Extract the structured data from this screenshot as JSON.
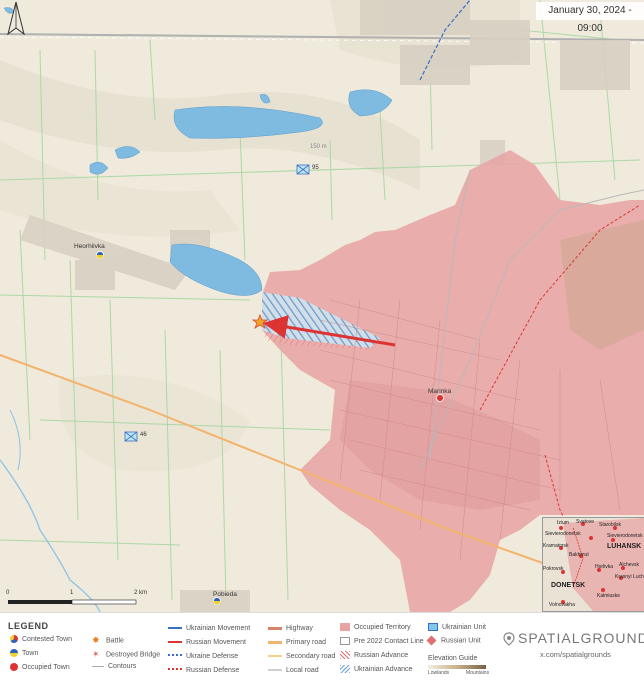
{
  "header": {
    "date": "January 30, 2024 - 09:00"
  },
  "map": {
    "towns": {
      "heorhiivka": "Heorhiivka",
      "marinka": "Marinka",
      "pobieda": "Pobieda"
    },
    "units": {
      "unit_95": "95",
      "unit_46": "46"
    },
    "contour_label": "150 m",
    "scale": {
      "zero": "0",
      "one": "1",
      "two": "2 km"
    }
  },
  "inset": {
    "towns": [
      "Izium",
      "Svatove",
      "Starobilsk",
      "Sievierodonetsk",
      "Sievierodonetsk",
      "Kramatorsk",
      "Bakhmut",
      "Pokrovsk",
      "Horlivka",
      "Alchevsk",
      "Krasnyi Luch",
      "Kalmiuske",
      "Volnovakha"
    ],
    "regions": {
      "luhansk": "LUHANSK",
      "donetsk": "DONETSK"
    }
  },
  "legend": {
    "title": "LEGEND",
    "contested_town": "Contested Town",
    "town": "Town",
    "occupied_town": "Occupied Town",
    "battle": "Battle",
    "destroyed_bridge": "Destroyed Bridge",
    "contours": "Contours",
    "ukrainian_movement": "Ukrainian Movement",
    "russian_movement": "Russian Movement",
    "ukraine_defense": "Ukraine Defense",
    "russian_defense": "Russian Defense",
    "highway": "Highway",
    "primary_road": "Primary road",
    "secondary_road": "Secondary road",
    "local_road": "Local road",
    "occupied_territory": "Occupied Territory",
    "contact_line": "Pre 2022 Contact Line",
    "russian_advance": "Russian Advance",
    "ukrainian_advance": "Ukrainian Advance",
    "ukrainian_unit": "Ukrainian Unit",
    "russian_unit": "Russian Unit",
    "elevation_guide": "Elevation Guide",
    "lowlands": "Lowlands",
    "mountains": "Mountains",
    "brand": "SPATIALGROUNDS",
    "url": "x.com/spatialgrounds"
  },
  "colors": {
    "occupied": "#e8a3a3",
    "water": "#7fbbe0",
    "field_line": "#9fd39a",
    "primary_road": "#f3b36a",
    "russian": "#d63b3b",
    "ukrainian": "#3a6fc6"
  }
}
